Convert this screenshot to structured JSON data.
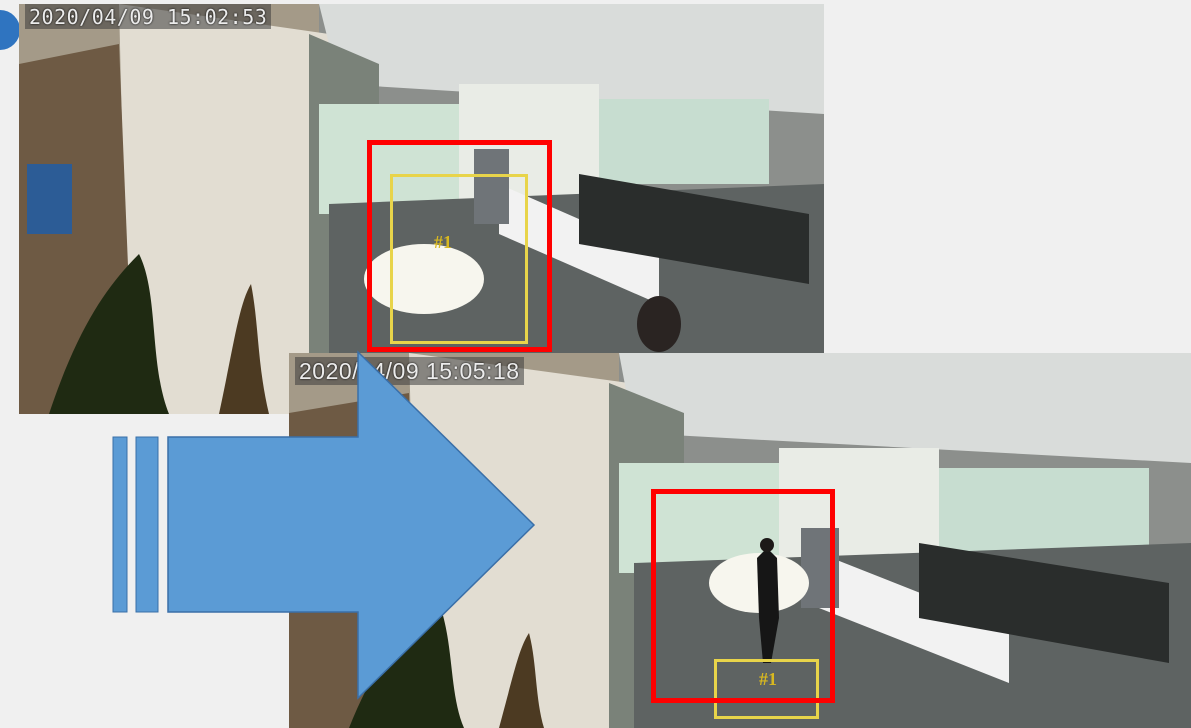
{
  "frame1": {
    "timestamp": "2020/04/09  15:02:53",
    "track_label": "#1"
  },
  "frame2": {
    "timestamp": "2020/04/09  15:05:18",
    "track_label": "#1"
  },
  "colors": {
    "detection_box": "#ff0000",
    "tracking_box": "#e8d44a",
    "arrow": "#5b9bd5",
    "badge": "#2f74c0"
  },
  "icons": {
    "arrow": "arrow-right-icon",
    "badge": "step-badge-icon"
  }
}
